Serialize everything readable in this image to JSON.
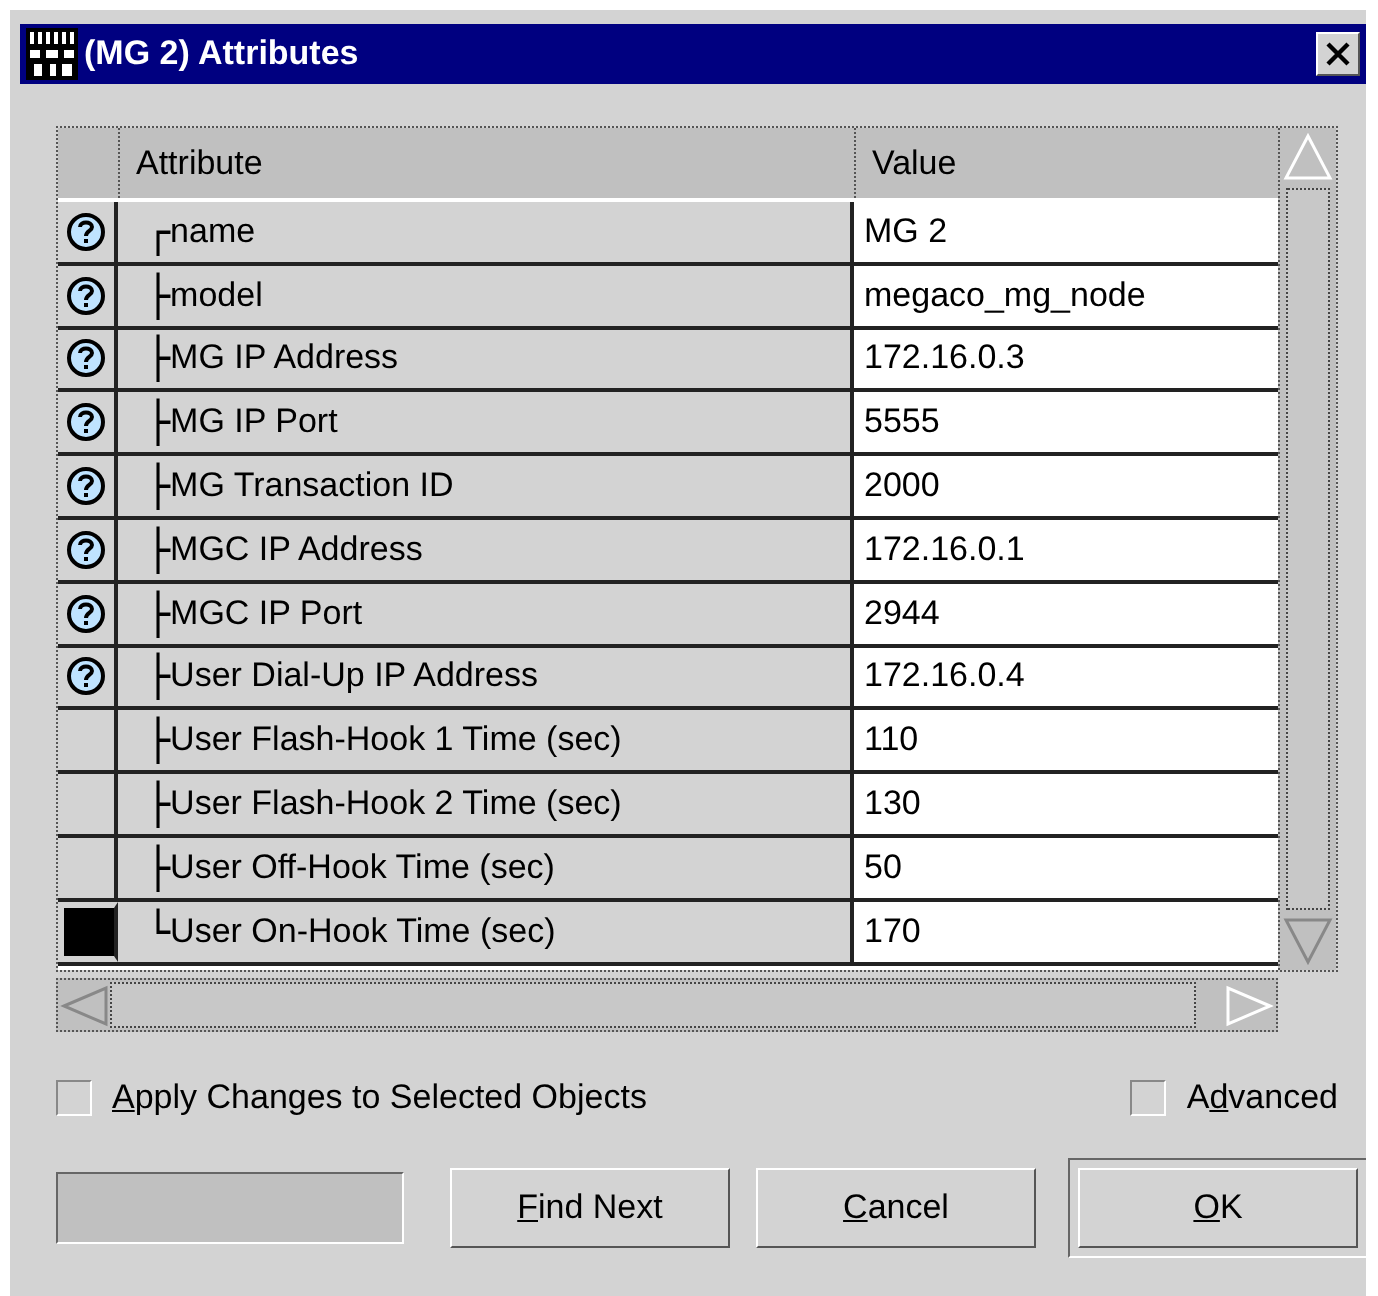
{
  "window": {
    "title": "(MG 2) Attributes"
  },
  "table": {
    "columns": [
      "Attribute",
      "Value"
    ],
    "rows": [
      {
        "help": true,
        "selected": false,
        "branch": "┌",
        "attribute": "name",
        "value": "MG 2"
      },
      {
        "help": true,
        "selected": false,
        "branch": "├",
        "attribute": "model",
        "value": "megaco_mg_node"
      },
      {
        "help": true,
        "selected": false,
        "branch": "├",
        "attribute": "MG IP Address",
        "value": "172.16.0.3"
      },
      {
        "help": true,
        "selected": false,
        "branch": "├",
        "attribute": "MG IP Port",
        "value": "5555"
      },
      {
        "help": true,
        "selected": false,
        "branch": "├",
        "attribute": "MG Transaction ID",
        "value": "2000"
      },
      {
        "help": true,
        "selected": false,
        "branch": "├",
        "attribute": "MGC IP Address",
        "value": "172.16.0.1"
      },
      {
        "help": true,
        "selected": false,
        "branch": "├",
        "attribute": "MGC IP Port",
        "value": "2944"
      },
      {
        "help": true,
        "selected": false,
        "branch": "├",
        "attribute": "User Dial-Up IP Address",
        "value": "172.16.0.4"
      },
      {
        "help": false,
        "selected": false,
        "branch": "├",
        "attribute": "User Flash-Hook 1 Time (sec)",
        "value": "110"
      },
      {
        "help": false,
        "selected": false,
        "branch": "├",
        "attribute": "User Flash-Hook 2 Time (sec)",
        "value": "130"
      },
      {
        "help": false,
        "selected": false,
        "branch": "├",
        "attribute": "User Off-Hook Time (sec)",
        "value": "50"
      },
      {
        "help": false,
        "selected": true,
        "branch": "└",
        "attribute": "User On-Hook Time (sec)",
        "value": "170"
      }
    ]
  },
  "options": [
    {
      "mnemonic": "A",
      "after": "pply Changes to Selected Objects",
      "checked": false
    },
    {
      "before": "A",
      "mnemonic": "d",
      "after": "vanced",
      "checked": false
    }
  ],
  "buttons": [
    {
      "mnemonic": "F",
      "after": "ind Next",
      "default": false
    },
    {
      "mnemonic": "C",
      "after": "ancel",
      "default": false
    },
    {
      "mnemonic": "O",
      "after": "K",
      "default": true
    }
  ]
}
